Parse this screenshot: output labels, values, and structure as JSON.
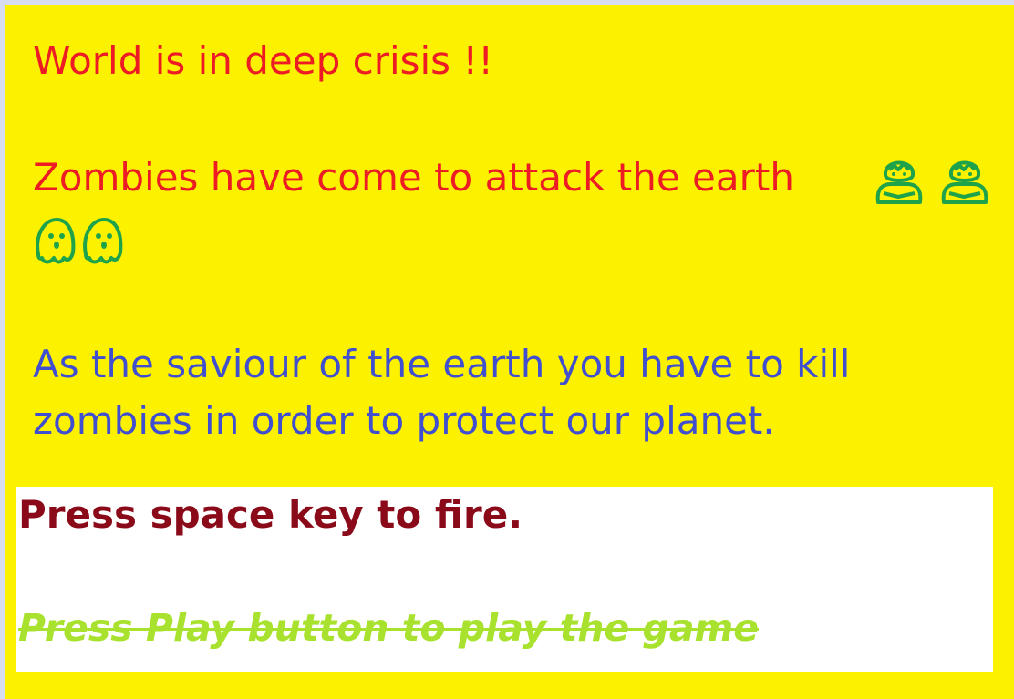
{
  "intro": {
    "headline": "World is in deep crisis !!",
    "zombie_line": "Zombies have come to attack the earth",
    "icons": [
      "zombie-icon",
      "zombie-icon",
      "ghost-icon",
      "ghost-icon"
    ],
    "mission_line_1": "As the saviour of the earth you have to kill",
    "mission_line_2": "zombies in order to protect our planet."
  },
  "instructions": {
    "fire": "Press space key to fire.",
    "play": "Press Play button to play the game"
  },
  "colors": {
    "background": "#fcf200",
    "headline": "#ed1c24",
    "mission": "#3f4fcf",
    "fire": "#8a0a1a",
    "play": "#a9e22e",
    "icon": "#1fa34a"
  }
}
